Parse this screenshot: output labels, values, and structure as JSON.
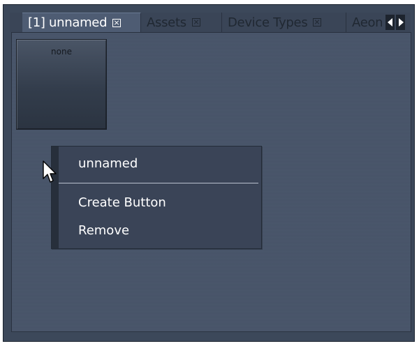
{
  "tabs": [
    {
      "label": "[1] unnamed",
      "active": true
    },
    {
      "label": "Assets",
      "active": false
    },
    {
      "label": "Device Types",
      "active": false
    },
    {
      "label": "Aeon",
      "active": false
    }
  ],
  "pad_button": {
    "label": "none"
  },
  "context_menu": {
    "title": "unnamed",
    "items": [
      "Create Button",
      "Remove"
    ]
  },
  "icons": {
    "tab_close": "close-box-icon",
    "scroll_left": "arrow-left-icon",
    "scroll_right": "arrow-right-icon",
    "cursor": "mouse-pointer-icon"
  },
  "colors": {
    "panel": "#475469",
    "menu": "#3a4457",
    "active_tab": "#4e5c73",
    "text": "#ffffff"
  }
}
